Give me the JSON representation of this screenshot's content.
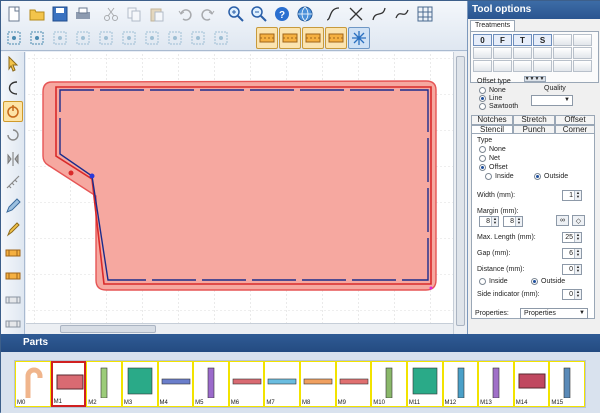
{
  "toolbar": {
    "row1": [
      "new-file-icon",
      "open-folder-icon",
      "save-icon",
      "print-icon",
      "cut-icon",
      "copy-icon",
      "paste-icon",
      "undo-icon",
      "redo-icon",
      "zoom-in-icon",
      "zoom-out-icon",
      "help-icon",
      "web-icon",
      "curve-tool-1-icon",
      "curve-tool-2-icon",
      "curve-tool-3-icon",
      "curve-tool-4-icon",
      "grid-icon"
    ],
    "row2": [
      "node-tool-1-icon",
      "node-tool-2-icon",
      "node-tool-3-icon",
      "node-tool-4-icon",
      "node-tool-5-icon",
      "node-tool-6-icon",
      "node-tool-7-icon",
      "node-tool-8-icon",
      "node-tool-9-icon",
      "node-tool-10-icon",
      "treatment-1-icon",
      "treatment-2-icon",
      "treatment-3-icon",
      "treatment-4-icon",
      "snowflake-icon"
    ]
  },
  "left_toolbar": [
    "pointer-icon",
    "arc-icon",
    "power-icon",
    "rotate-icon",
    "mirror-icon",
    "measure-icon",
    "pencil-icon",
    "pen-icon",
    "notch-1-icon",
    "notch-2-icon",
    "notch-3-icon",
    "notch-4-icon"
  ],
  "colors": {
    "accent": "#2b5590",
    "shape_fill": "#f6a8a0",
    "shape_stroke": "#d92a2a",
    "offset_line": "#1a2c8c"
  },
  "panel": {
    "title": "Tool options",
    "top_tab": "Treatments",
    "treatment_buttons": [
      "0",
      "F",
      "T",
      "S",
      "",
      "",
      "",
      "",
      "",
      "",
      "",
      "",
      "",
      "",
      "",
      "",
      "",
      ""
    ],
    "offset_type": {
      "label": "Offset type",
      "options": [
        "None",
        "Line",
        "Sawtooth"
      ],
      "selected": "Line"
    },
    "quality": {
      "label": "Quality",
      "value": ""
    },
    "tabs_row1": [
      "Notches",
      "Stretch",
      "Offset"
    ],
    "tabs_row2": [
      "Stencil",
      "Punch",
      "Corner"
    ],
    "active_tab": "Stencil",
    "type": {
      "label": "Type",
      "options": [
        "None",
        "Net",
        "Offset"
      ],
      "selected": "Offset",
      "side_options": [
        "Inside",
        "Outside"
      ],
      "side_selected": "Outside"
    },
    "width": {
      "label": "Width (mm):",
      "value": "1"
    },
    "margin": {
      "label": "Margin (mm):",
      "value1": "8",
      "value2": "8"
    },
    "max_length": {
      "label": "Max. Length (mm):",
      "value": "25"
    },
    "gap": {
      "label": "Gap (mm):",
      "value": "6"
    },
    "distance": {
      "label": "Distance (mm):",
      "value": "0",
      "options": [
        "Inside",
        "Outside"
      ],
      "selected": "Outside"
    },
    "side_indicator": {
      "label": "Side indicator (mm):",
      "value": "0"
    },
    "properties": {
      "label": "Properties:",
      "value": "Properties"
    }
  },
  "parts": {
    "title": "Parts",
    "items": [
      {
        "label": "M0",
        "shape": "hook",
        "color": "#f0b58c"
      },
      {
        "label": "M1",
        "shape": "rect",
        "color": "#d96a72"
      },
      {
        "label": "M2",
        "shape": "tall",
        "color": "#9ccc7a"
      },
      {
        "label": "M3",
        "shape": "square",
        "color": "#2aaa88"
      },
      {
        "label": "M4",
        "shape": "bar",
        "color": "#6a7ecb"
      },
      {
        "label": "M5",
        "shape": "tall",
        "color": "#9b6acb"
      },
      {
        "label": "M6",
        "shape": "bar",
        "color": "#d96a72"
      },
      {
        "label": "M7",
        "shape": "bar",
        "color": "#6abde0"
      },
      {
        "label": "M8",
        "shape": "bar",
        "color": "#f0a060"
      },
      {
        "label": "M9",
        "shape": "bar",
        "color": "#e07070"
      },
      {
        "label": "M10",
        "shape": "tall",
        "color": "#8ab86a"
      },
      {
        "label": "M11",
        "shape": "square",
        "color": "#2aaa88"
      },
      {
        "label": "M12",
        "shape": "tall",
        "color": "#4aa0c8"
      },
      {
        "label": "M13",
        "shape": "tall",
        "color": "#a070c8"
      },
      {
        "label": "M14",
        "shape": "rect",
        "color": "#c04860"
      },
      {
        "label": "M15",
        "shape": "tall",
        "color": "#5a8ab8"
      }
    ],
    "selected": "M1"
  }
}
